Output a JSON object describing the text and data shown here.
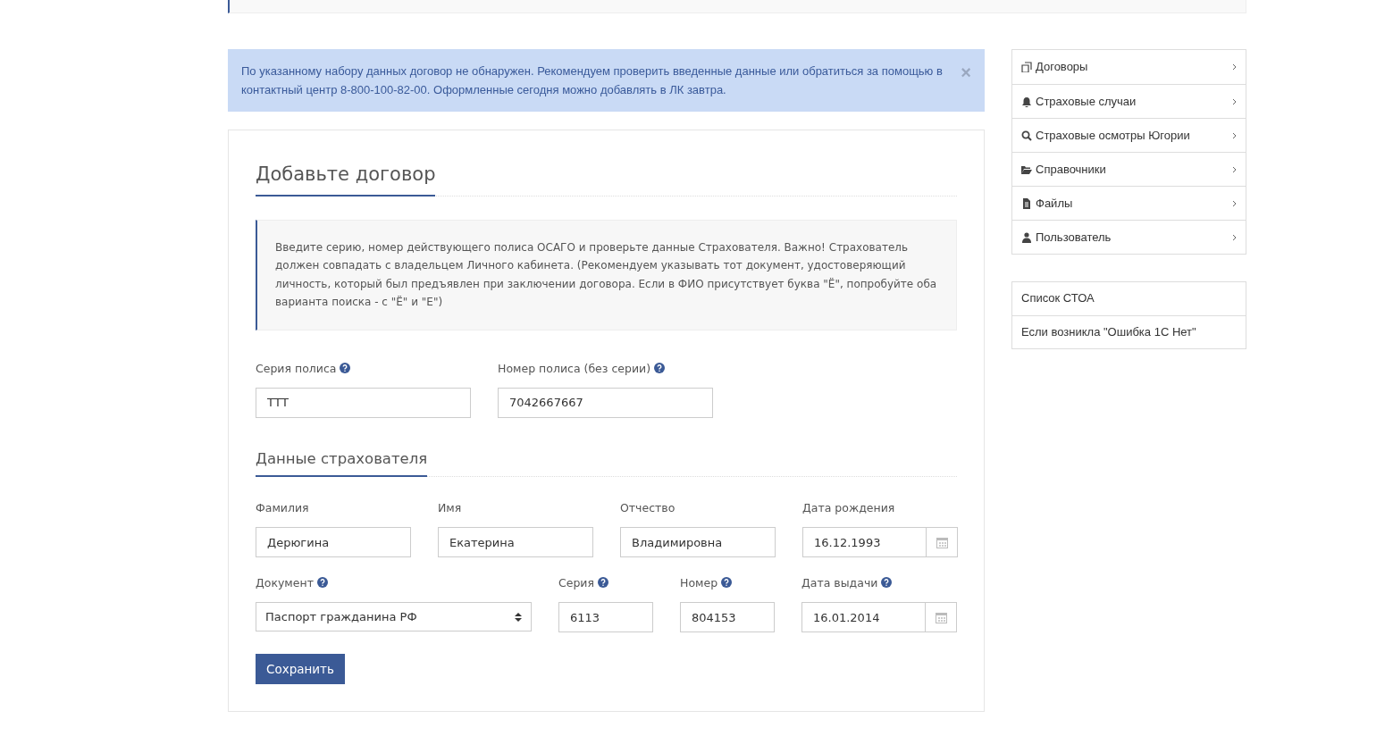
{
  "alert": {
    "text": "По указанному набору данных договор не обнаружен. Рекомендуем проверить введенные данные или обратиться за помощью в контактный центр 8-800-100-82-00. Оформленные сегодня можно добавлять в ЛК завтра.",
    "close": "×"
  },
  "form": {
    "title": "Добавьте договор",
    "info": "Введите серию, номер действующего полиса ОСАГО и проверьте данные Страхователя. Важно! Страхователь должен совпадать с владельцем Личного кабинета. (Рекомендуем указывать тот документ, удостоверяющий личность, который был предъявлен при заключении договора. Если в ФИО присутствует буква \"Ё\", попробуйте оба варианта поиска - с \"Ё\" и \"Е\")",
    "policy_fields": [
      {
        "label": "Серия полиса",
        "help": true,
        "kind": "text",
        "value": "ТТТ"
      },
      {
        "label": "Номер полиса (без серии)",
        "help": true,
        "kind": "text",
        "value": "7042667667"
      }
    ],
    "section_title": "Данные страхователя",
    "person_fields": [
      {
        "label": "Фамилия",
        "help": false,
        "kind": "text",
        "value": "Дерюгина"
      },
      {
        "label": "Имя",
        "help": false,
        "kind": "text",
        "value": "Екатерина"
      },
      {
        "label": "Отчество",
        "help": false,
        "kind": "text",
        "value": "Владимировна"
      },
      {
        "label": "Дата рождения",
        "help": false,
        "kind": "date",
        "value": "16.12.1993"
      }
    ],
    "document_fields": [
      {
        "label": "Документ",
        "help": true,
        "kind": "select",
        "value": "Паспорт гражданина РФ"
      },
      {
        "label": "Серия",
        "help": true,
        "kind": "text",
        "value": "6113"
      },
      {
        "label": "Номер",
        "help": true,
        "kind": "text",
        "value": "804153"
      },
      {
        "label": "Дата выдачи",
        "help": true,
        "kind": "date",
        "value": "16.01.2014"
      }
    ],
    "save_button": "Сохранить"
  },
  "sidebar": {
    "menu": [
      {
        "kind": "copy",
        "label": "Договоры"
      },
      {
        "kind": "bell",
        "label": "Страховые случаи"
      },
      {
        "kind": "search",
        "label": "Страховые осмотры Югории"
      },
      {
        "kind": "folder",
        "label": "Справочники"
      },
      {
        "kind": "file",
        "label": "Файлы"
      },
      {
        "kind": "user",
        "label": "Пользователь"
      }
    ],
    "links": [
      "Список СТОА",
      "Если возникла \"Ошибка 1С Нет\""
    ]
  }
}
